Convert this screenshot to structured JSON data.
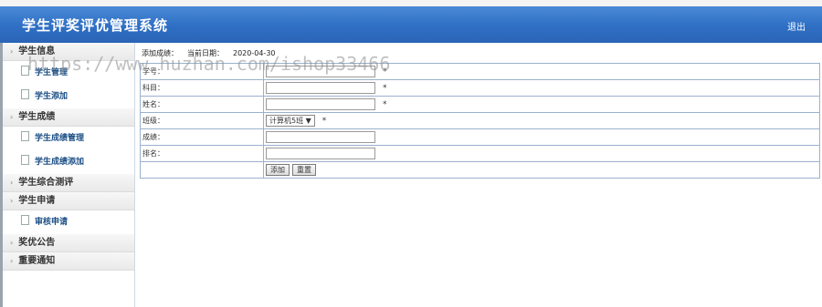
{
  "header": {
    "title": "学生评奖评优管理系统",
    "logout": "退出"
  },
  "sidebar": [
    {
      "label": "学生信息",
      "items": [
        "学生管理",
        "学生添加"
      ]
    },
    {
      "label": "学生成绩",
      "items": [
        "学生成绩管理",
        "学生成绩添加"
      ]
    },
    {
      "label": "学生综合测评",
      "items": []
    },
    {
      "label": "学生申请",
      "items": [
        "审核申请"
      ]
    },
    {
      "label": "奖优公告",
      "items": []
    },
    {
      "label": "重要通知",
      "items": []
    }
  ],
  "main": {
    "section_title": "添加成绩：",
    "date_label": "当前日期：",
    "date_value": "2020-04-30",
    "fields": [
      {
        "label": "学号：",
        "value": "",
        "required": "*"
      },
      {
        "label": "科目：",
        "value": "",
        "required": "*"
      },
      {
        "label": "姓名：",
        "value": "",
        "required": "*"
      },
      {
        "label": "班级：",
        "select": "计算机5班 ▼",
        "required": "*"
      },
      {
        "label": "成绩：",
        "value": ""
      },
      {
        "label": "排名：",
        "value": ""
      }
    ],
    "buttons": {
      "add": "添加",
      "reset": "重置"
    }
  },
  "watermark": "https://www.huzhan.com/ishop33466",
  "colors": {
    "header": "#2f6fc4",
    "link": "#1b4f85",
    "border": "#9bb1cc"
  }
}
